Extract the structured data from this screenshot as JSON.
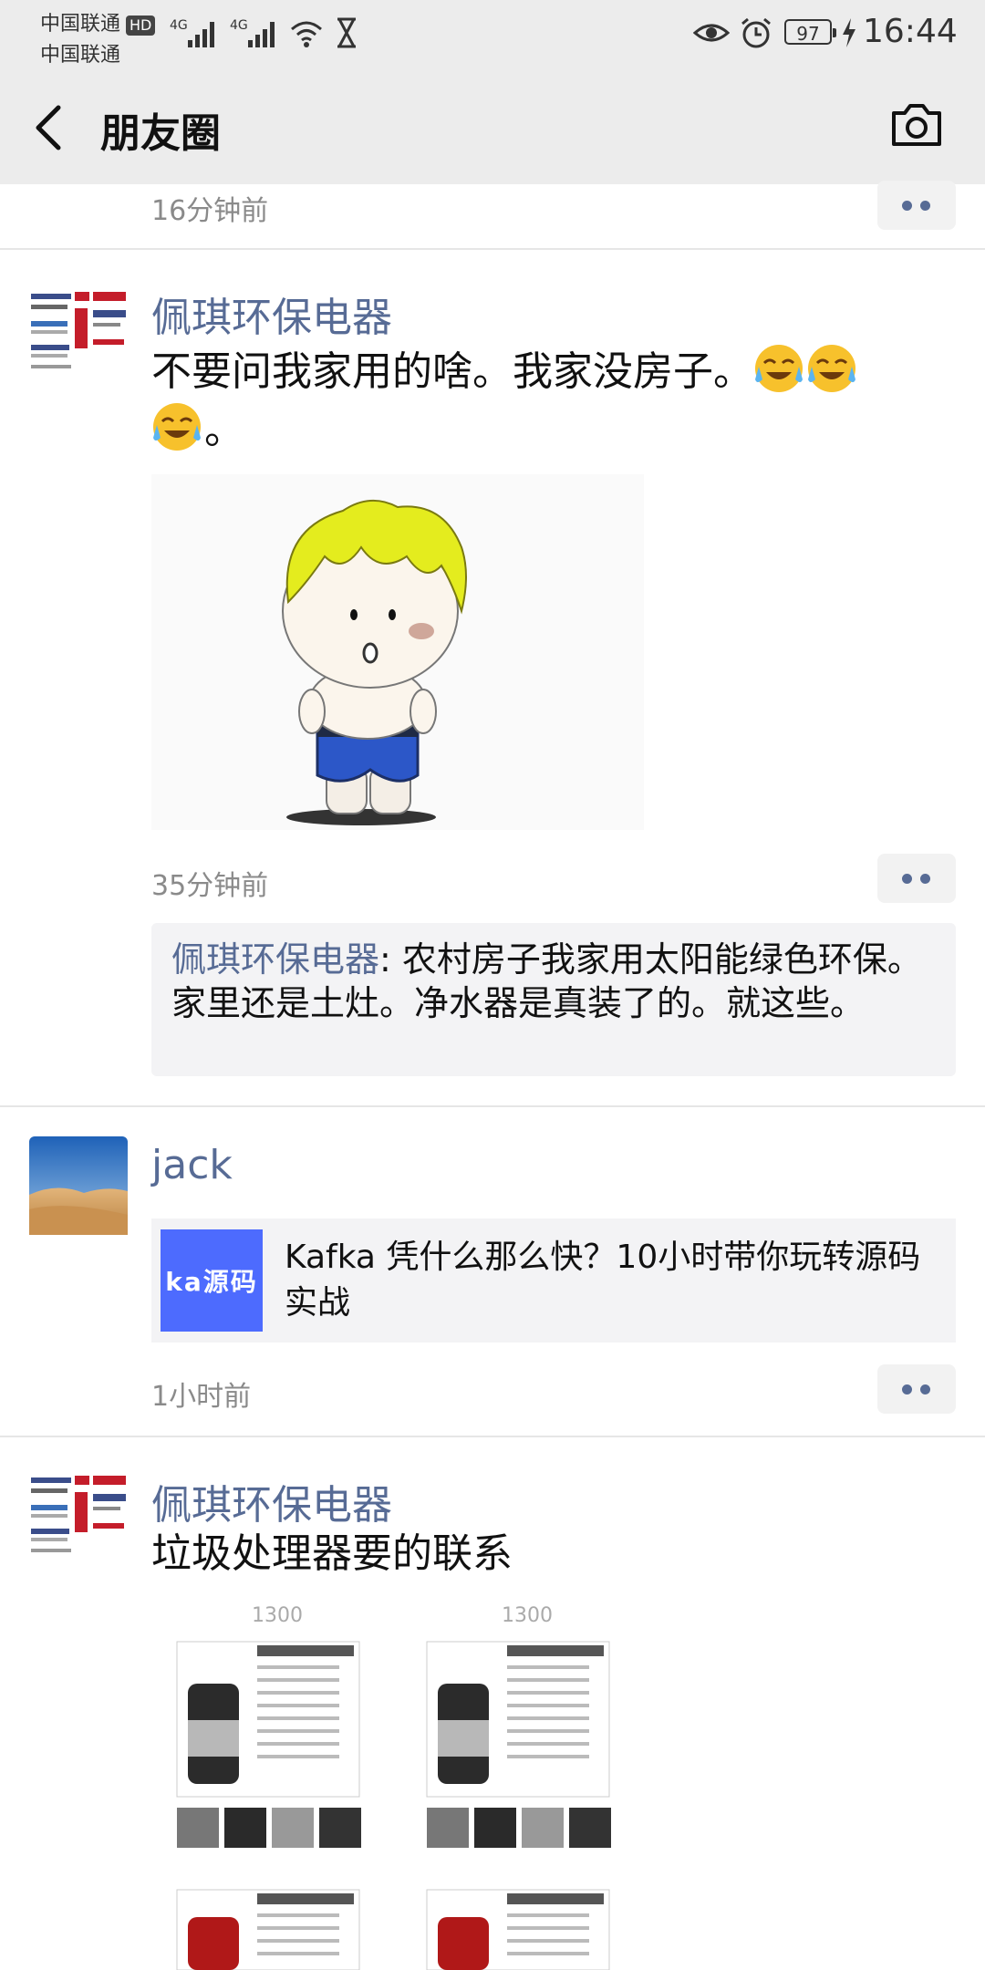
{
  "status_bar": {
    "carrier1": "中国联通",
    "hd": "HD",
    "carrier2": "中国联通",
    "net1": "4G",
    "net2": "4G",
    "battery": "97",
    "time": "16:44"
  },
  "header": {
    "title": "朋友圈",
    "back_icon": "chevron-left-icon",
    "camera_icon": "camera-icon"
  },
  "posts": [
    {
      "time": "16分钟前"
    },
    {
      "author": "佩琪环保电器",
      "text": "不要问我家用的啥。我家没房子。",
      "text_tail": "。",
      "time": "35分钟前",
      "comment": {
        "author": "佩琪环保电器",
        "sep": ": ",
        "text": "农村房子我家用太阳能绿色环保。家里还是土灶。净水器是真装了的。就这些。"
      }
    },
    {
      "author": "jack",
      "share": {
        "thumb_text": "ka源码",
        "title": "Kafka 凭什么那么快？10小时带你玩转源码实战"
      },
      "time": "1小时前"
    },
    {
      "author": "佩琪环保电器",
      "text": "垃圾处理器要的联系",
      "image_caption_1": "1300",
      "image_caption_2": "1300"
    }
  ],
  "colors": {
    "link": "#576b95",
    "header_bg": "#ececec",
    "card_bg": "#f3f3f5",
    "share_thumb": "#4d6bfe"
  }
}
